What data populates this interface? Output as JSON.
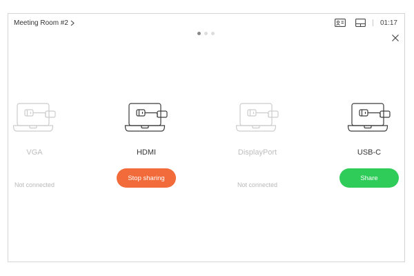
{
  "header": {
    "room_title": "Meeting Room #2",
    "time": "01:17",
    "camera_icon": "self-view-camera-icon",
    "layout_icon": "layout-icon",
    "close_icon": "close-icon"
  },
  "pager": {
    "pages": 3,
    "active_index": 0
  },
  "sources": [
    {
      "name": "VGA",
      "status": "Not connected",
      "connected": false,
      "action": ""
    },
    {
      "name": "HDMI",
      "status": "",
      "connected": true,
      "action": "Stop sharing"
    },
    {
      "name": "DisplayPort",
      "status": "Not connected",
      "connected": false,
      "action": ""
    },
    {
      "name": "USB-C",
      "status": "",
      "connected": true,
      "action": "Share"
    }
  ],
  "colors": {
    "stop_sharing": "#f26b3a",
    "share": "#2fcc59",
    "connected_icon": "#3a3a3a",
    "disconnected_icon": "#cccccc"
  }
}
